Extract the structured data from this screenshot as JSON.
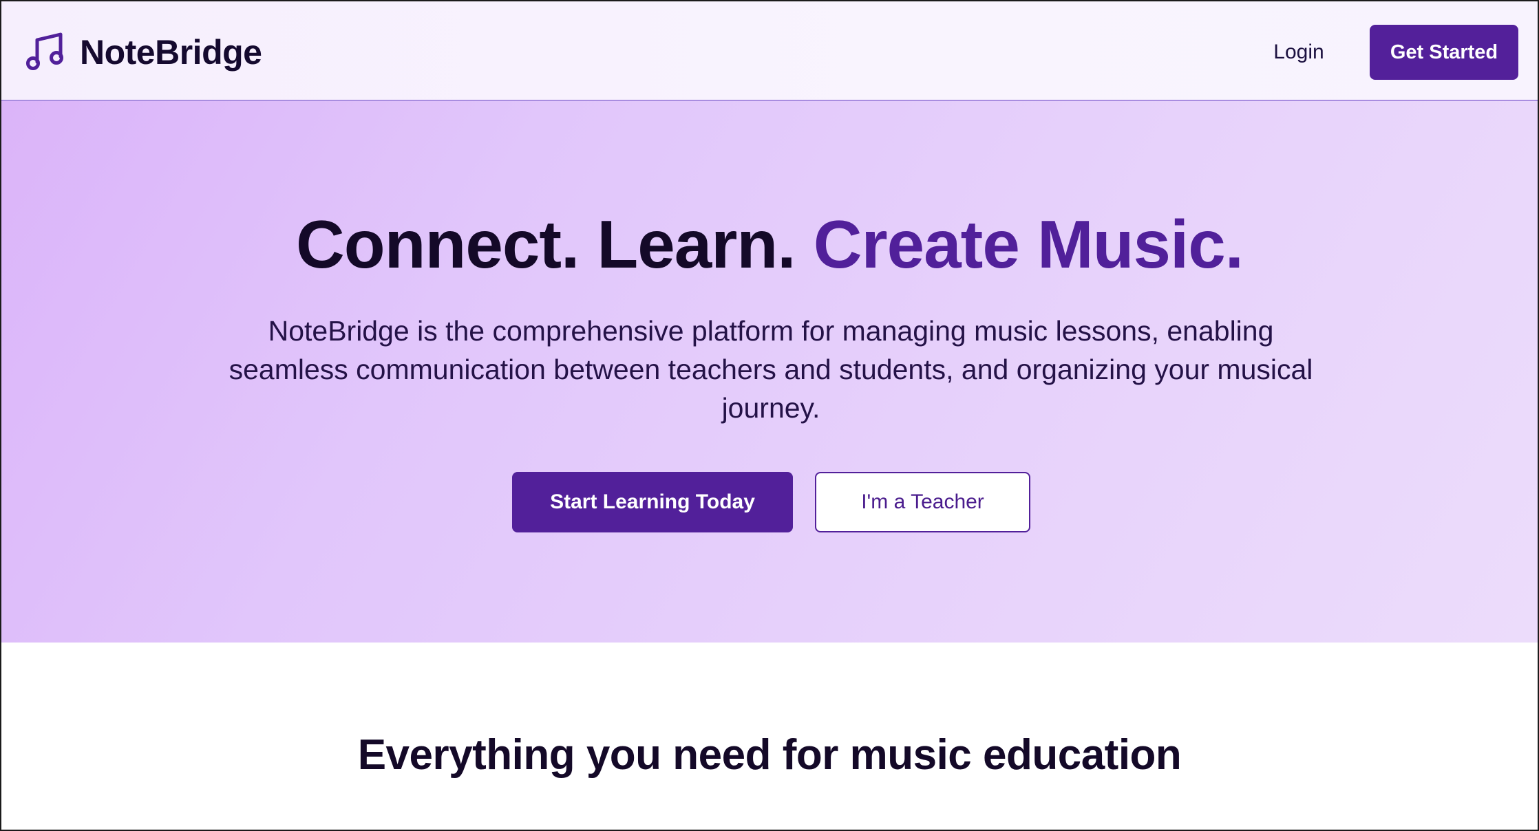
{
  "header": {
    "brand": {
      "name": "NoteBridge",
      "icon": "music-note-icon"
    },
    "nav": {
      "login_label": "Login",
      "cta_label": "Get Started"
    }
  },
  "hero": {
    "title_main": "Connect. Learn.",
    "title_accent": "Create Music.",
    "subtitle": "NoteBridge is the comprehensive platform for managing music lessons, enabling seamless communication between teachers and students, and organizing your musical journey.",
    "primary_button_label": "Start Learning Today",
    "secondary_button_label": "I'm a Teacher"
  },
  "features": {
    "heading": "Everything you need for music education"
  },
  "colors": {
    "brand_purple": "#52209a",
    "hero_gradient_start": "#dbb4f9",
    "hero_gradient_end": "#ecdcfb",
    "text_dark": "#140928",
    "header_background": "#f6effd"
  }
}
